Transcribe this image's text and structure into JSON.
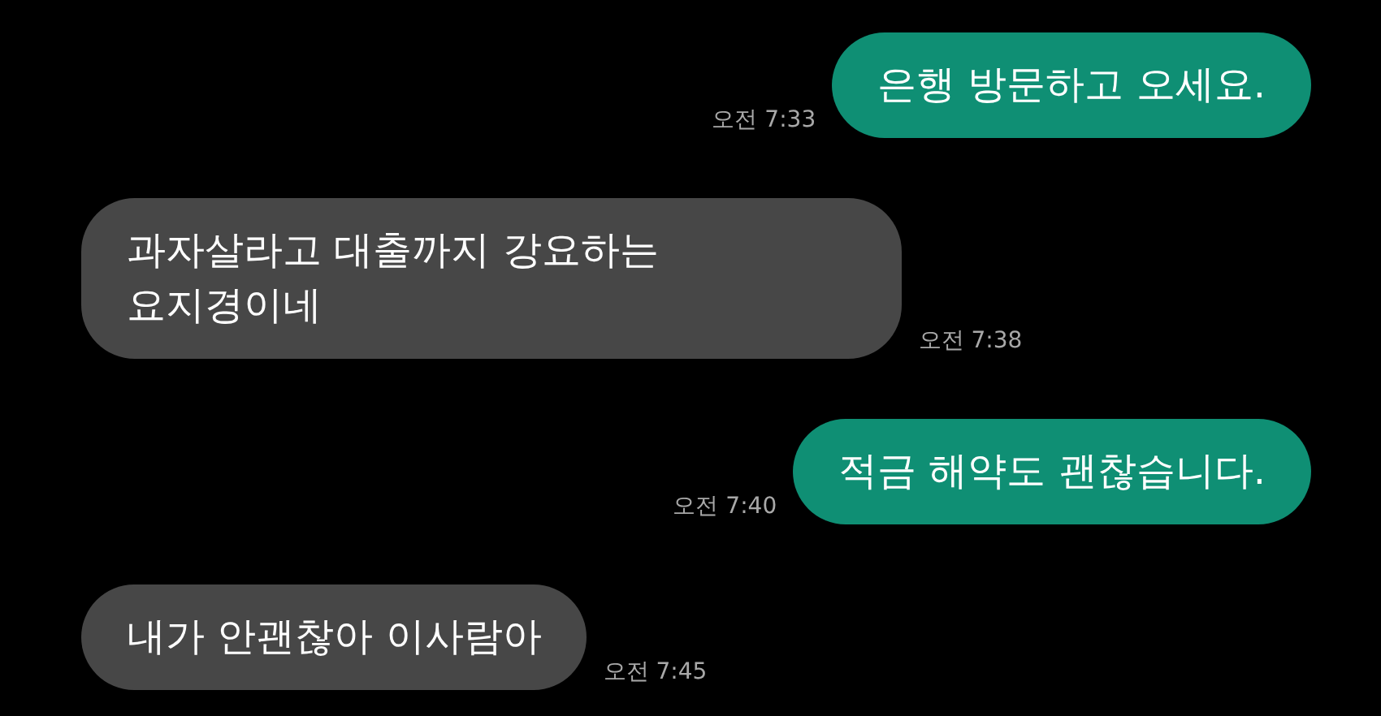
{
  "messages": [
    {
      "kind": "sent",
      "text": "은행 방문하고 오세요.",
      "time": "오전 7:33"
    },
    {
      "kind": "received",
      "text": "과자살라고 대출까지 강요하는\n요지경이네",
      "time": "오전 7:38"
    },
    {
      "kind": "sent",
      "text": "적금 해약도 괜찮습니다.",
      "time": "오전 7:40"
    },
    {
      "kind": "received",
      "text": "내가 안괜찮아 이사람아",
      "time": "오전 7:45"
    }
  ]
}
